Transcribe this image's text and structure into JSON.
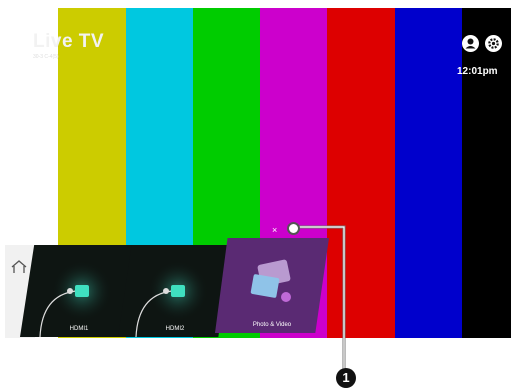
{
  "header": {
    "title": "Live TV",
    "subtitle": "30-3 C-4(5)",
    "time": "12:01pm"
  },
  "top_icons": [
    "user-icon",
    "settings-gear-icon"
  ],
  "launcher": {
    "home_icon": "home-icon",
    "cards": [
      {
        "label": "HDMI1",
        "icon": "hdmi-cable-icon"
      },
      {
        "label": "HDMI2",
        "icon": "hdmi-cable-icon"
      },
      {
        "label": "Photo & Video",
        "icon": "photo-video-icon"
      }
    ],
    "close_glyph": "×"
  },
  "callout": {
    "number": "1"
  },
  "colors": {
    "bars": [
      "#ffffff",
      "#cccc00",
      "#00c8e0",
      "#00cc00",
      "#cc00cc",
      "#dd0000",
      "#0000cc",
      "#000000"
    ],
    "photo_card": "#5a2a73"
  }
}
